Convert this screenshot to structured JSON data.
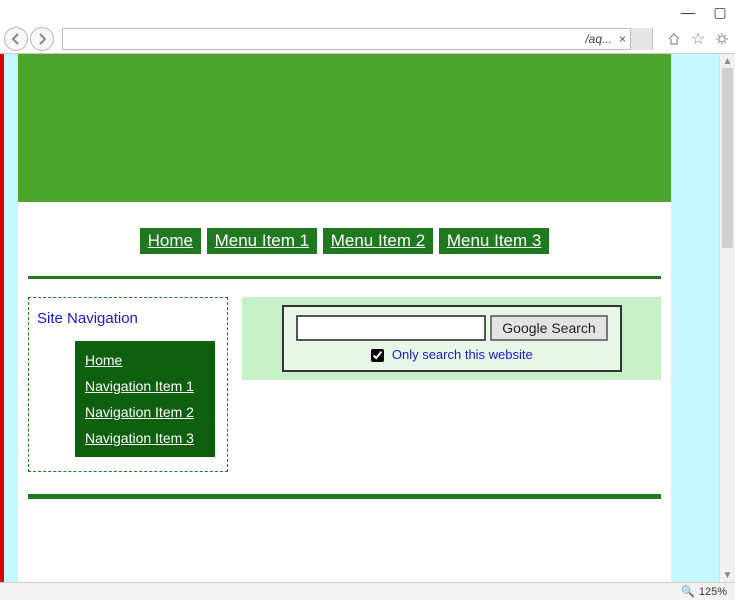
{
  "browser": {
    "tab_label": "/aq...",
    "zoom": "125%"
  },
  "menu": {
    "items": [
      "Home",
      "Menu Item 1",
      "Menu Item 2",
      "Menu Item 3"
    ]
  },
  "sidenav": {
    "title": "Site Navigation",
    "items": [
      "Home",
      "Navigation Item 1",
      "Navigation Item 2",
      "Navigation Item 3"
    ]
  },
  "search": {
    "button_label": "Google Search",
    "checkbox_label": "Only search this website",
    "checked": true
  }
}
